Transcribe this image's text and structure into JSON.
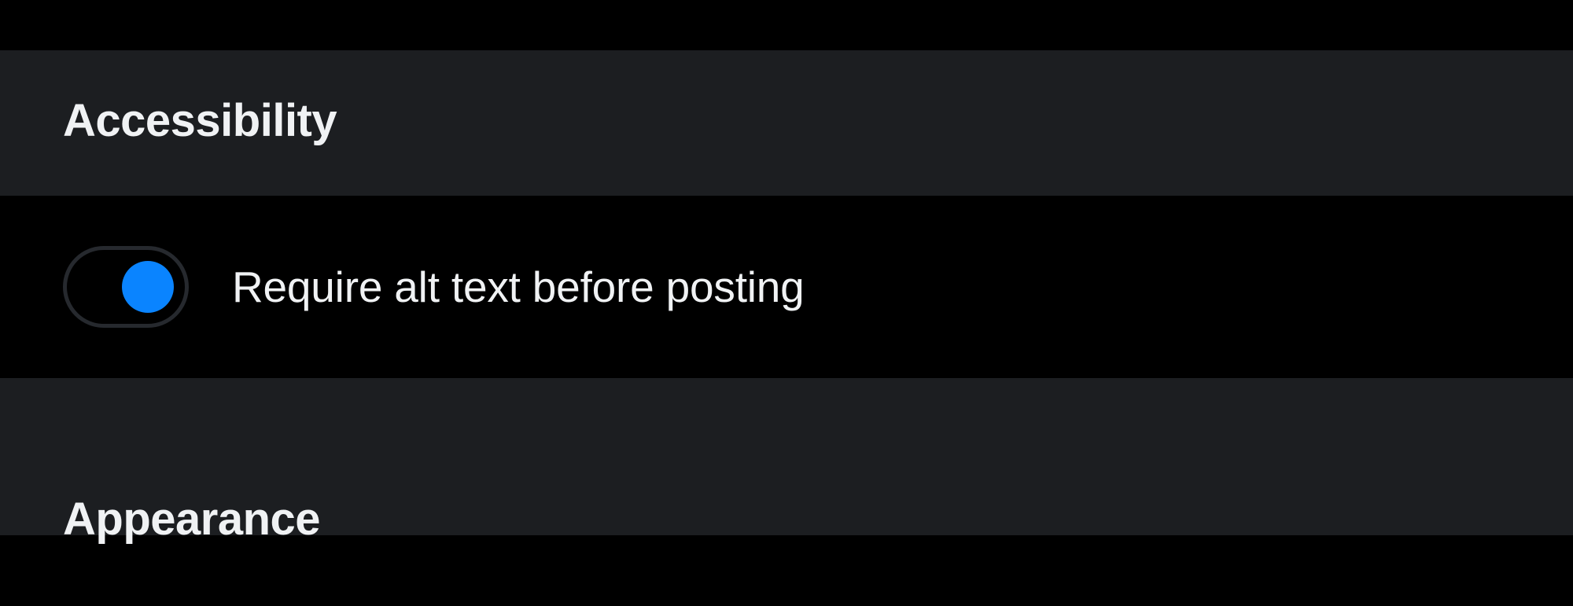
{
  "sections": {
    "accessibility": {
      "title": "Accessibility",
      "settings": {
        "require_alt_text": {
          "label": "Require alt text before posting",
          "enabled": true
        }
      }
    },
    "appearance": {
      "title": "Appearance"
    }
  },
  "colors": {
    "background": "#000000",
    "section_bg": "#1C1E21",
    "text": "#F0F2F4",
    "accent": "#0A84FF",
    "toggle_border": "#26292E"
  }
}
